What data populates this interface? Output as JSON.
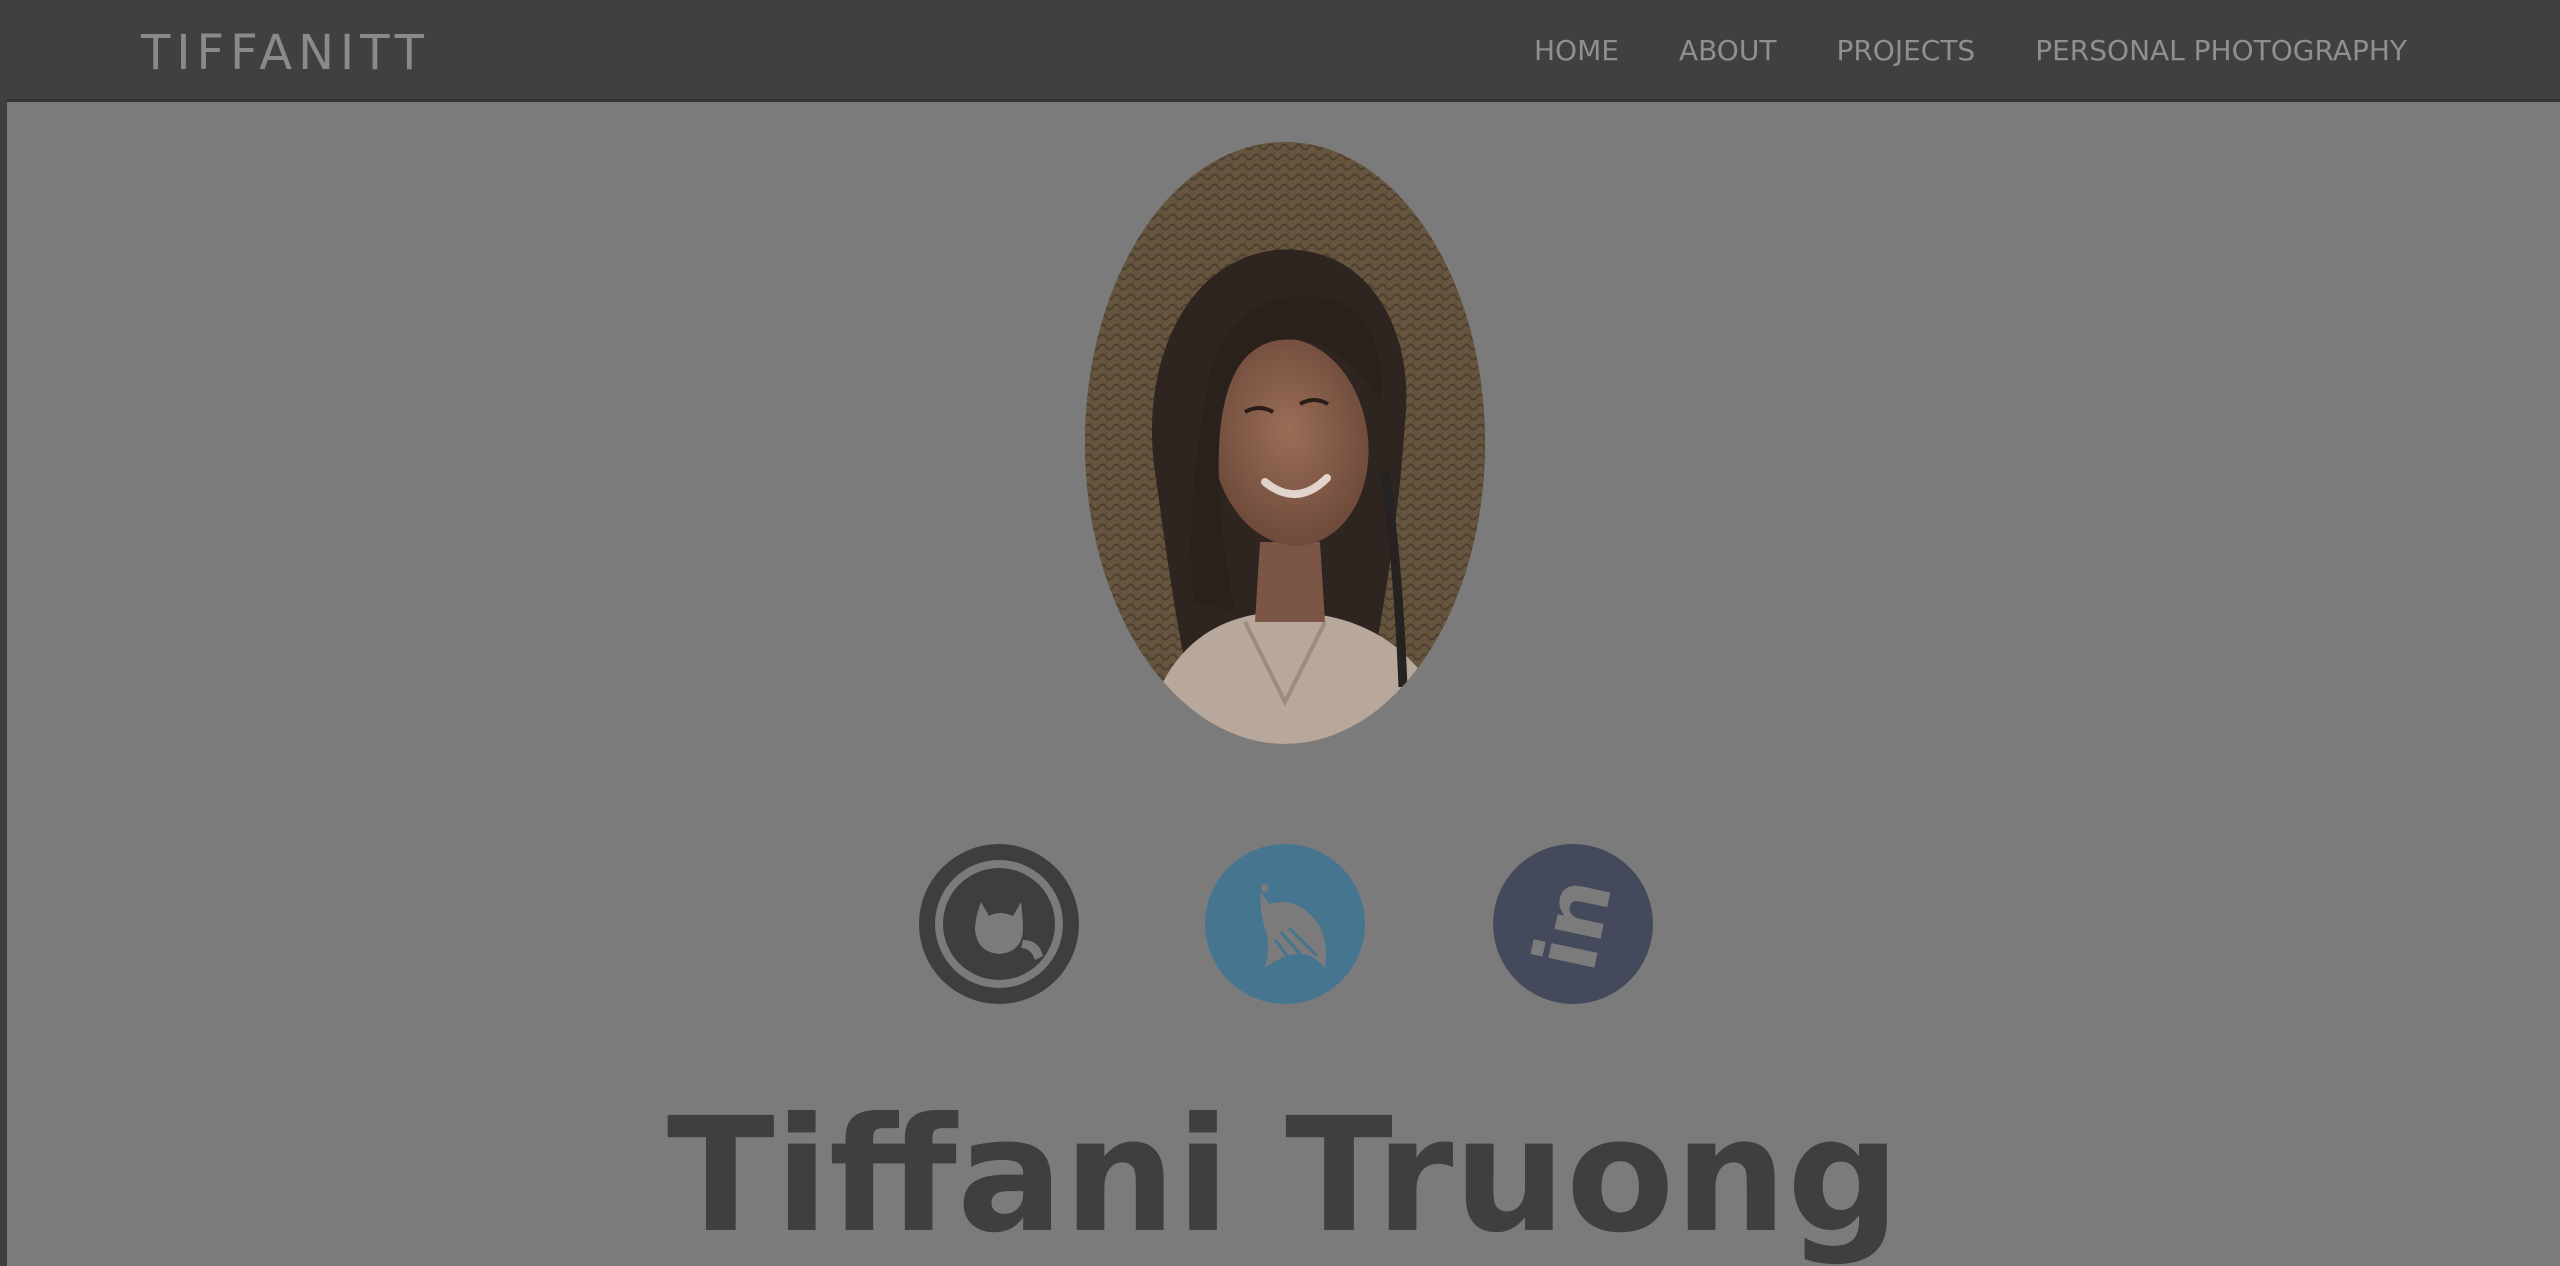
{
  "brand": "TIFFANITT",
  "nav": {
    "home": "HOME",
    "about": "ABOUT",
    "projects": "PROJECTS",
    "photography": "PERSONAL PHOTOGRAPHY"
  },
  "social": {
    "icons": [
      "github-octocat-icon",
      "twitter-bird-icon",
      "linkedin-in-icon"
    ],
    "colors": {
      "github": "#3e3e3e",
      "twitter": "#46758f",
      "linkedin": "#444a5c"
    }
  },
  "profile": {
    "name": "Tiffani Truong"
  }
}
